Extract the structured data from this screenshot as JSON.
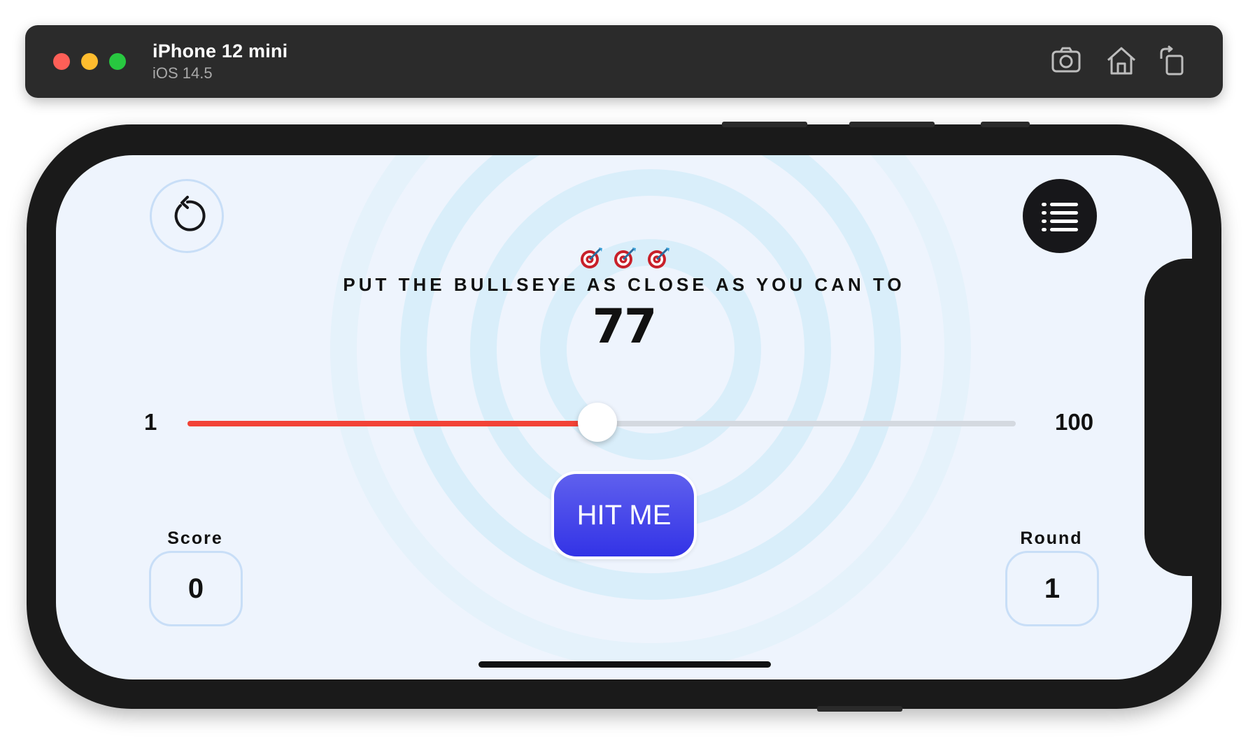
{
  "simulator": {
    "device_name": "iPhone 12 mini",
    "os_version": "iOS 14.5",
    "toolbar_icons": [
      "screenshot-icon",
      "home-icon",
      "rotate-icon"
    ]
  },
  "game": {
    "instruction": "PUT THE BULLSEYE AS CLOSE AS YOU CAN TO",
    "target": "77",
    "slider": {
      "min_label": "1",
      "max_label": "100",
      "min": 1,
      "max": 100,
      "value": 50
    },
    "hit_button": "HIT ME",
    "score_label": "Score",
    "score_value": "0",
    "round_label": "Round",
    "round_value": "1",
    "icons": [
      "restart-icon",
      "leaderboard-icon",
      "target-icon"
    ]
  },
  "colors": {
    "background": "#eef4fd",
    "slider_fill": "#f24236",
    "button_top": "#5f60ee",
    "button_bottom": "#3333e6",
    "ring": "#d9eefa"
  }
}
